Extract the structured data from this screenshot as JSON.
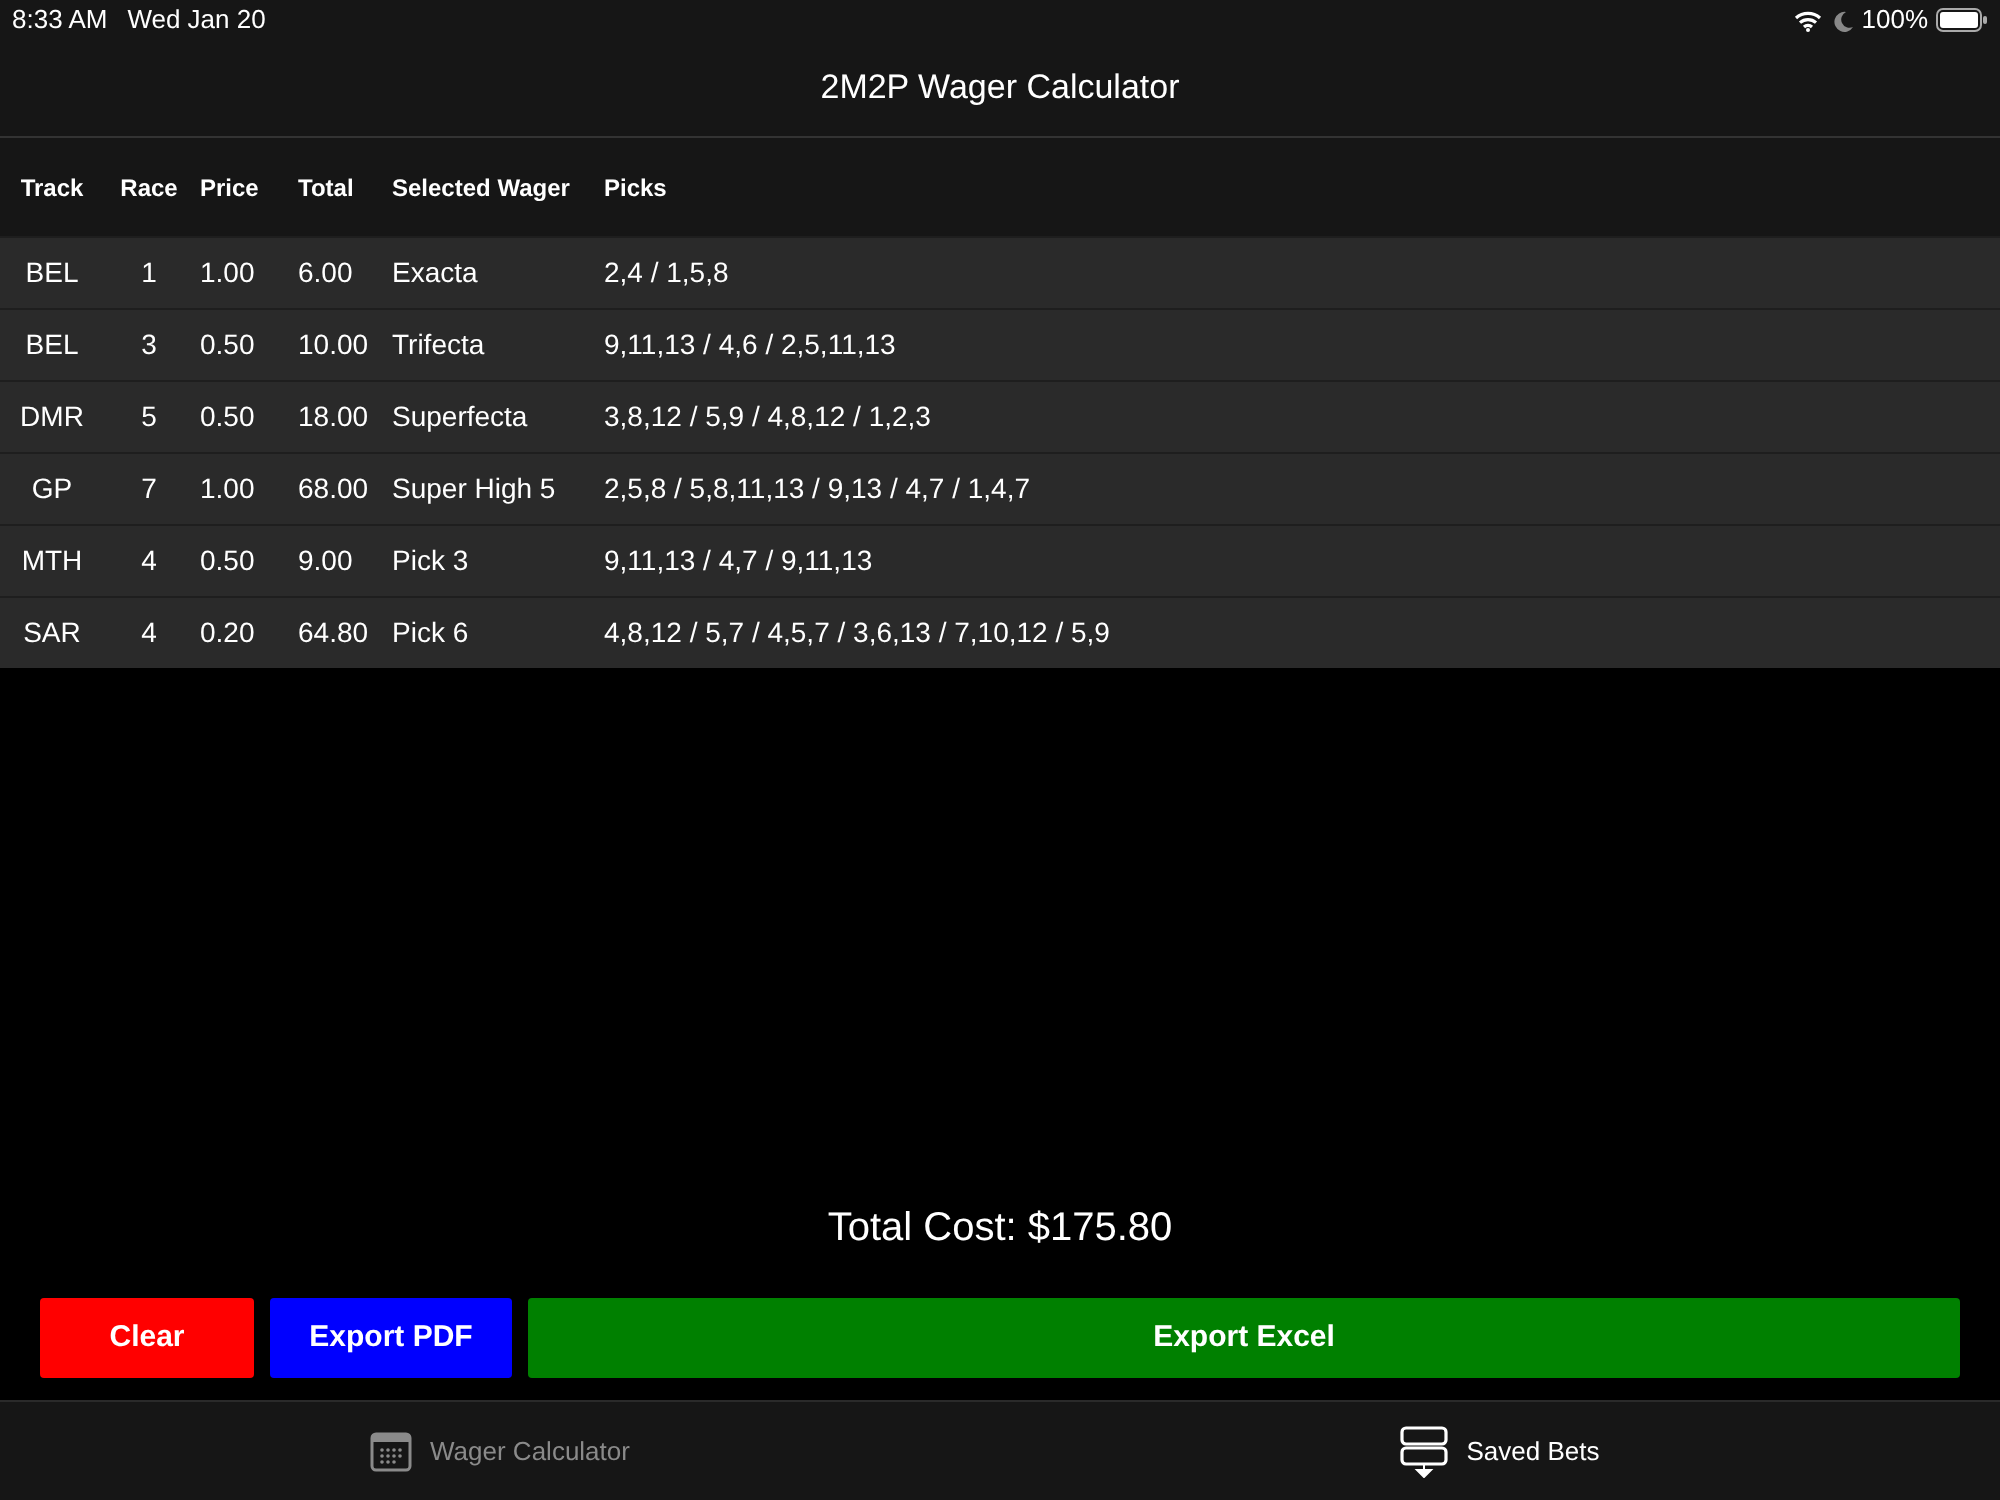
{
  "status_bar": {
    "time": "8:33 AM",
    "date": "Wed Jan 20",
    "battery": "100%"
  },
  "nav": {
    "title": "2M2P Wager Calculator"
  },
  "table": {
    "columns": [
      "Track",
      "Race",
      "Price",
      "Total",
      "Selected Wager",
      "Picks"
    ],
    "rows": [
      [
        "BEL",
        "1",
        "1.00",
        "6.00",
        "Exacta",
        "2,4 / 1,5,8"
      ],
      [
        "BEL",
        "3",
        "0.50",
        "10.00",
        "Trifecta",
        "9,11,13 / 4,6 / 2,5,11,13"
      ],
      [
        "DMR",
        "5",
        "0.50",
        "18.00",
        "Superfecta",
        "3,8,12 / 5,9 / 4,8,12 / 1,2,3"
      ],
      [
        "GP",
        "7",
        "1.00",
        "68.00",
        "Super High 5",
        "2,5,8 / 5,8,11,13 / 9,13 / 4,7 / 1,4,7"
      ],
      [
        "MTH",
        "4",
        "0.50",
        "9.00",
        "Pick 3",
        "9,11,13 / 4,7 / 9,11,13"
      ],
      [
        "SAR",
        "4",
        "0.20",
        "64.80",
        "Pick 6",
        "4,8,12 / 5,7 / 4,5,7 / 3,6,13 / 7,10,12 / 5,9"
      ]
    ]
  },
  "total_cost": "Total Cost: $175.80",
  "buttons": [
    {
      "label": "Clear",
      "color": "#ff0000"
    },
    {
      "label": "Export PDF",
      "color": "#0000ff"
    },
    {
      "label": "Export Excel",
      "color": "#008000"
    }
  ],
  "tab_bar": [
    {
      "label": "Wager Calculator",
      "kind": "calendar",
      "selected": false
    },
    {
      "label": "Saved Bets",
      "kind": "saved",
      "selected": true
    }
  ]
}
